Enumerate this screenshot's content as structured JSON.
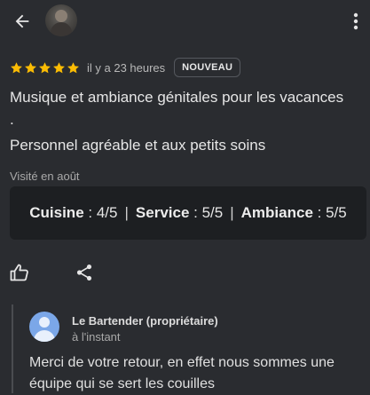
{
  "header": {
    "back_icon": "arrow-left-icon",
    "avatar_icon": "user-photo",
    "more_icon": "more-vert-icon"
  },
  "review": {
    "rating": 5,
    "star_color": "#fbbc04",
    "time": "il y a 23 heures",
    "badge": "NOUVEAU",
    "text_line1": "Musique et ambiance génitales pour les vacances",
    "text_line2": ".",
    "text_line3": "Personnel agréable et aux petits soins",
    "visited": "Visité en août"
  },
  "scores": {
    "food_label": "Cuisine",
    "food_value": ": 4/5",
    "service_label": "Service",
    "service_value": ": 5/5",
    "ambiance_label": "Ambiance",
    "ambiance_value": ": 5/5",
    "separator": "|"
  },
  "actions": {
    "like_icon": "thumb-up-icon",
    "share_icon": "share-icon"
  },
  "owner_reply": {
    "name": "Le Bartender (propriétaire)",
    "time": "à l'instant",
    "text": "Merci de votre retour, en effet nous sommes une équipe qui se sert les couilles"
  }
}
